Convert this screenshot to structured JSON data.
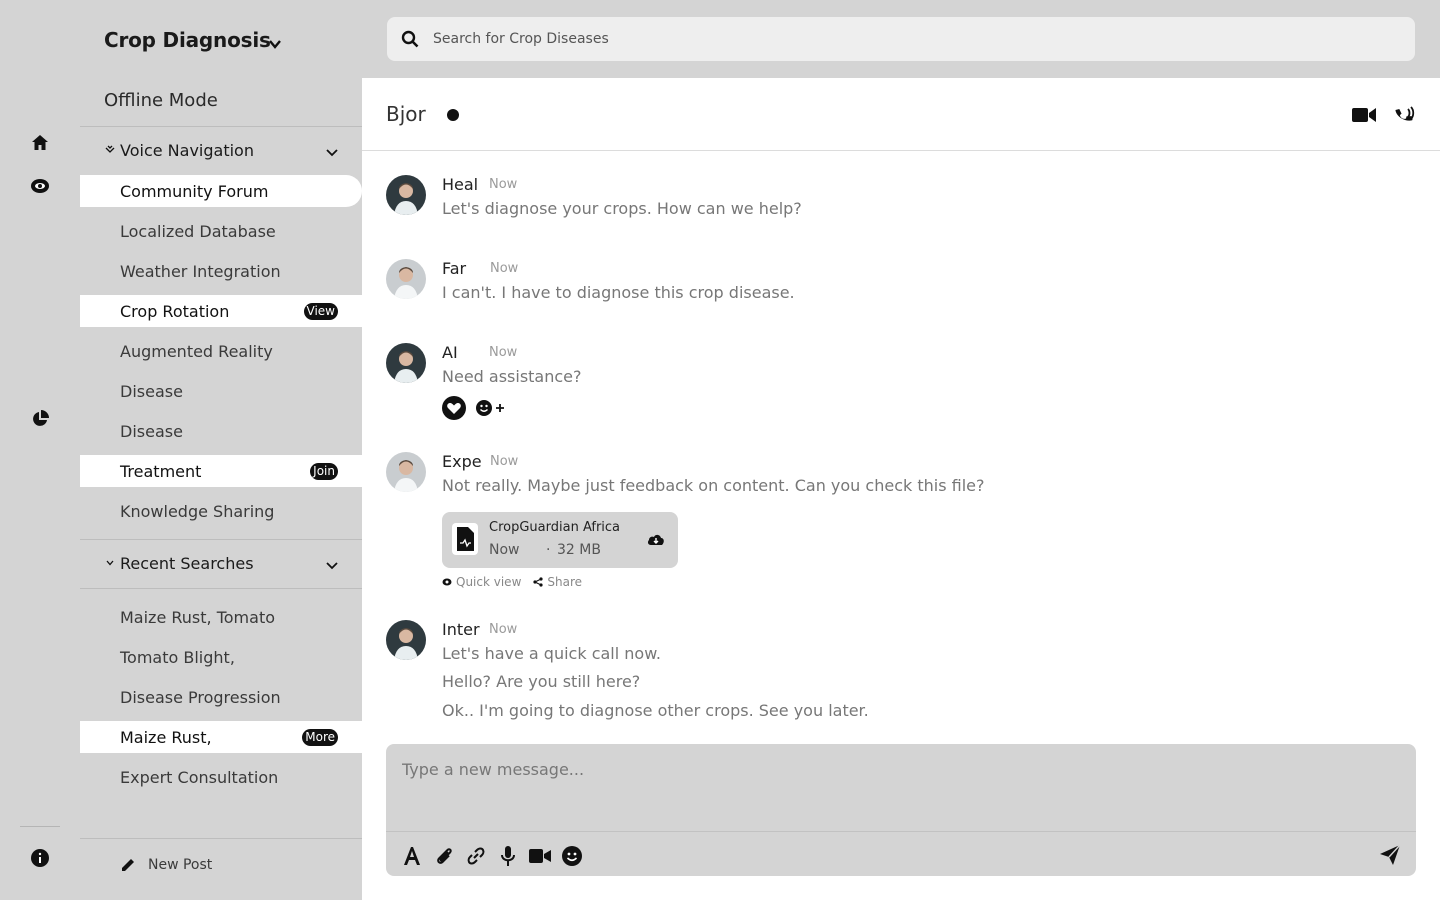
{
  "sidebar": {
    "brand": "Crop Diagnosis",
    "offline_mode": "Offline Mode",
    "voice_navigation": "Voice Navigation",
    "nav_items": [
      {
        "label": "Community Forum"
      },
      {
        "label": "Localized Database"
      },
      {
        "label": "Weather Integration"
      },
      {
        "label": "Crop Rotation",
        "badge": "View"
      },
      {
        "label": "Augmented Reality"
      },
      {
        "label": "Disease"
      },
      {
        "label": "Disease"
      },
      {
        "label": "Treatment",
        "badge": "Join"
      },
      {
        "label": "Knowledge Sharing"
      }
    ],
    "recent_searches_label": "Recent Searches",
    "recent_items": [
      {
        "label": "Maize Rust, Tomato"
      },
      {
        "label": "Tomato Blight,"
      },
      {
        "label": "Disease Progression"
      },
      {
        "label": "Maize Rust,",
        "badge": "More"
      },
      {
        "label": "Expert Consultation"
      }
    ],
    "new_post": "New Post"
  },
  "search": {
    "placeholder": "Search for Crop Diseases"
  },
  "chat": {
    "title": "Bjor",
    "messages": [
      {
        "name": "Heal",
        "time": "Now",
        "lines": [
          "Let's diagnose your crops. How can we help?"
        ]
      },
      {
        "name": "Far",
        "time": "Now",
        "lines": [
          "I can't. I have to diagnose this crop disease."
        ]
      },
      {
        "name": "AI",
        "time": "Now",
        "lines": [
          "Need assistance?"
        ]
      },
      {
        "name": "Expe",
        "time": "Now",
        "lines": [
          "Not really. Maybe just feedback on content. Can you check this file?"
        ]
      },
      {
        "name": "Inter",
        "time": "Now",
        "lines": [
          "Let's have a quick call now.",
          "Hello? Are you still here?",
          "Ok.. I'm going to diagnose other crops. See you later."
        ]
      }
    ],
    "file": {
      "name": "CropGuardian Africa",
      "time": "Now",
      "size": "32 MB",
      "quick_view": "Quick view",
      "share": "Share"
    }
  },
  "composer": {
    "placeholder": "Type a new message..."
  },
  "colors": {
    "background": "#d4d4d4",
    "panel": "#ffffff",
    "accent": "#111111"
  }
}
